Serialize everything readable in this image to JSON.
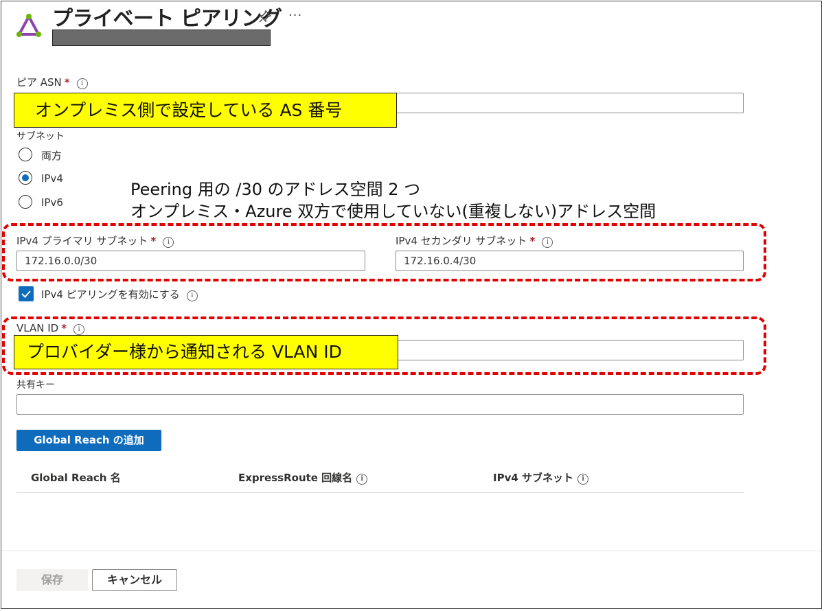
{
  "header": {
    "title": "プライベート ピアリング",
    "pin_icon": "pin-icon",
    "more_label": "···"
  },
  "form": {
    "peer_asn": {
      "label": "ピア ASN",
      "required": "*",
      "value": ""
    },
    "subnet": {
      "label": "サブネット",
      "options": [
        "両方",
        "IPv4",
        "IPv6"
      ],
      "selected": "IPv4"
    },
    "ipv4_primary": {
      "label": "IPv4 プライマリ サブネット",
      "required": "*",
      "value": "172.16.0.0/30"
    },
    "ipv4_secondary": {
      "label": "IPv4 セカンダリ サブネット",
      "required": "*",
      "value": "172.16.0.4/30"
    },
    "enable_ipv4": {
      "label": "IPv4 ピアリングを有効にする",
      "checked": true
    },
    "vlan_id": {
      "label": "VLAN ID",
      "required": "*",
      "value": ""
    },
    "shared_key": {
      "label": "共有キー",
      "value": ""
    },
    "info_glyph": "i"
  },
  "global_reach": {
    "add_button": "Global Reach の追加",
    "columns": [
      "Global Reach 名",
      "ExpressRoute 回線名",
      "IPv4 サブネット"
    ]
  },
  "footer": {
    "save_label": "保存",
    "cancel_label": "キャンセル"
  },
  "annotations": {
    "asn_callout": "オンプレミス側で設定している AS 番号",
    "subnet_note_line1": "Peering 用の /30 のアドレス空間 2 つ",
    "subnet_note_line2": "オンプレミス・Azure 双方で使用していない(重複しない)アドレス空間",
    "vlan_callout": "プロバイダー様から通知される VLAN ID"
  },
  "colors": {
    "accent": "#0f6cbd",
    "required": "#a4262c",
    "callout_bg": "#ffff00",
    "highlight_border": "#e30000",
    "logo": "#8e44ad"
  }
}
